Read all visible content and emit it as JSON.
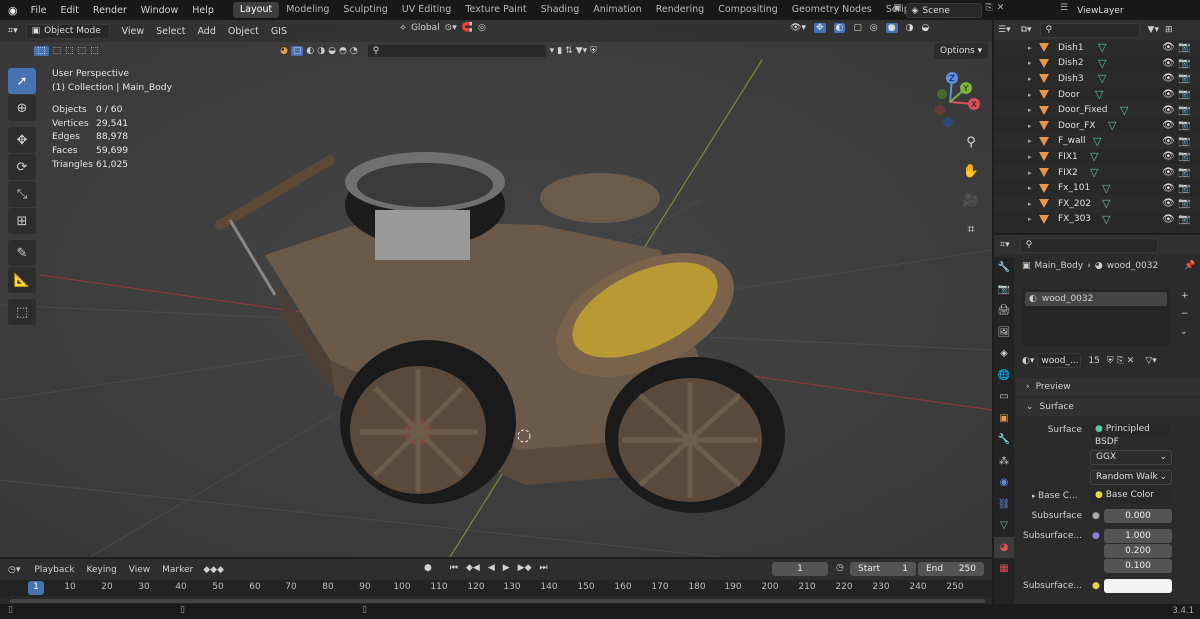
{
  "top_menu": [
    "File",
    "Edit",
    "Render",
    "Window",
    "Help"
  ],
  "workspaces": [
    "Layout",
    "Modeling",
    "Sculpting",
    "UV Editing",
    "Texture Paint",
    "Shading",
    "Animation",
    "Rendering",
    "Compositing",
    "Geometry Nodes",
    "Scripting"
  ],
  "active_workspace": "Layout",
  "add_tab": "+",
  "scene": "Scene",
  "view_layer": "ViewLayer",
  "viewport": {
    "mode": "Object Mode",
    "menus": [
      "View",
      "Select",
      "Add",
      "Object",
      "GIS"
    ],
    "transform_orientation": "Global",
    "options": "Options",
    "view_name": "User Perspective",
    "collection": "(1) Collection | Main_Body",
    "stats": [
      {
        "k": "Objects",
        "v": "0 / 60"
      },
      {
        "k": "Vertices",
        "v": "29,541"
      },
      {
        "k": "Edges",
        "v": "88,978"
      },
      {
        "k": "Faces",
        "v": "59,699"
      },
      {
        "k": "Triangles",
        "v": "61,025"
      }
    ],
    "gizmo": {
      "x": "X",
      "y": "Y",
      "z": "Z"
    }
  },
  "outliner": {
    "items": [
      "Dish1",
      "Dish2",
      "Dish3",
      "Door",
      "Door_Fixed",
      "Door_FX",
      "F_wall",
      "FIX1",
      "FIX2",
      "Fx_101",
      "FX_202",
      "FX_303"
    ]
  },
  "properties": {
    "breadcrumb_object": "Main_Body",
    "breadcrumb_material": "wood_0032",
    "slot_name": "wood_0032",
    "material_name": "wood_...",
    "users": "15",
    "preview": "Preview",
    "surface_panel": "Surface",
    "surface_label": "Surface",
    "surface_shader": "Principled BSDF",
    "distribution": "GGX",
    "subsurface_method": "Random Walk",
    "base_color_label": "Base C...",
    "base_color_value": "Base Color",
    "subsurface_label": "Subsurface",
    "subsurface_value": "0.000",
    "subsurface_radius_label": "Subsurface...",
    "radius": [
      "1.000",
      "0.200",
      "0.100"
    ],
    "subsurface_color_label": "Subsurface..."
  },
  "timeline": {
    "menus": [
      "Playback",
      "Keying",
      "View",
      "Marker"
    ],
    "current_frame": "1",
    "start_label": "Start",
    "start": "1",
    "end_label": "End",
    "end": "250",
    "ruler": [
      "1",
      "10",
      "20",
      "30",
      "40",
      "50",
      "60",
      "70",
      "80",
      "90",
      "100",
      "110",
      "120",
      "130",
      "140",
      "150",
      "160",
      "170",
      "180",
      "190",
      "200",
      "210",
      "220",
      "230",
      "240",
      "250"
    ]
  },
  "version": "3.4.1",
  "colors": {
    "accent": "#4772b3",
    "object_orange": "#e8964a",
    "mesh_green": "#5ac9a0"
  }
}
